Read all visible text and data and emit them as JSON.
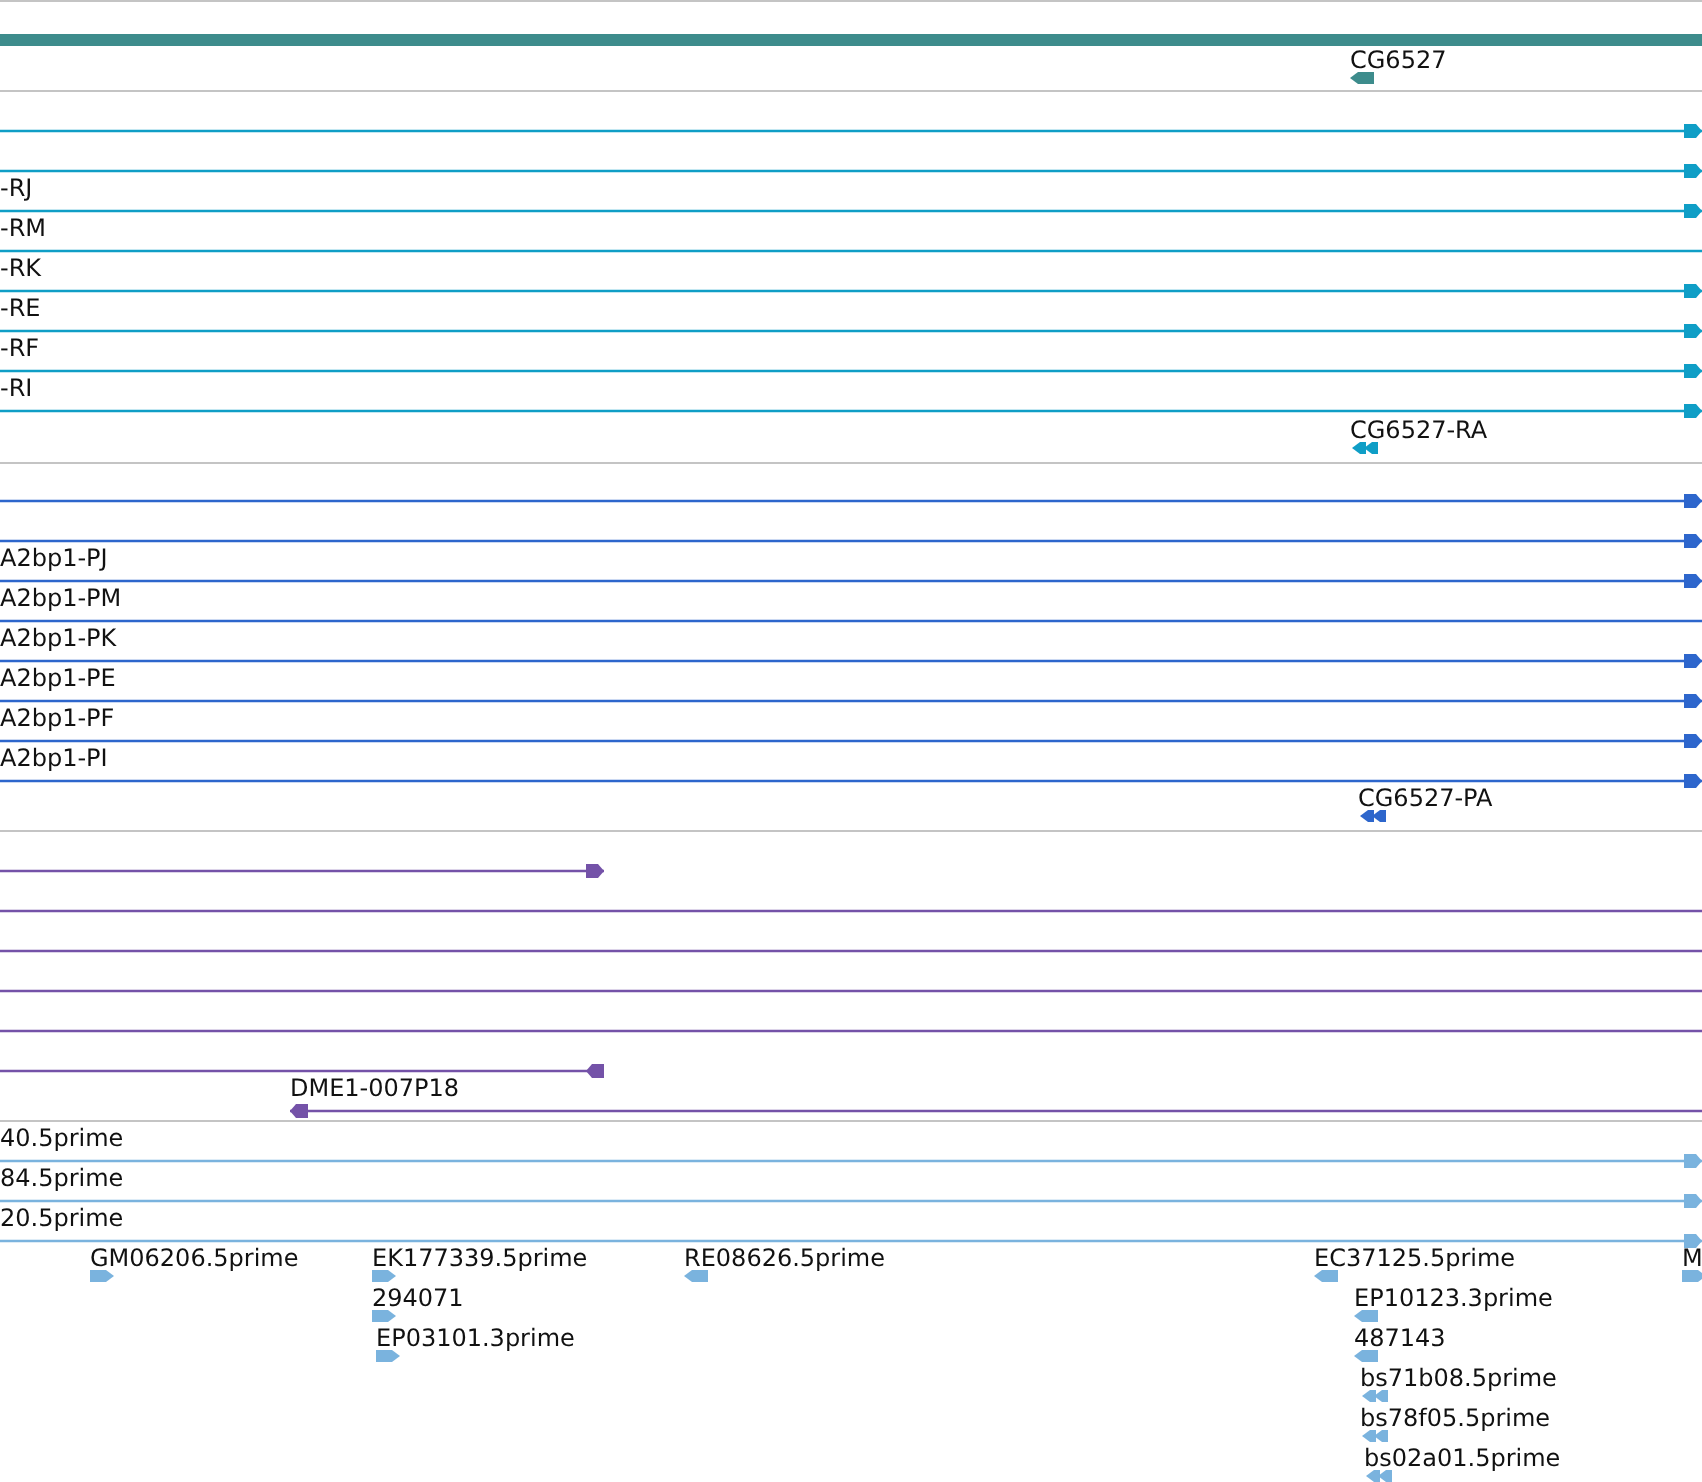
{
  "tracks": [
    {
      "kind": "gene",
      "color": "#3d8c8c",
      "features": [
        {
          "label": "CG6527",
          "reverse": true,
          "kind": "single"
        }
      ]
    },
    {
      "kind": "rows",
      "color": "#0f9ec6",
      "rows": [
        {
          "marker": true
        },
        {
          "marker": true
        },
        {
          "label": "-RJ",
          "marker": true
        },
        {
          "label": "-RM",
          "marker": false
        },
        {
          "label": "-RK",
          "marker": true
        },
        {
          "label": "-RE",
          "marker": true
        },
        {
          "label": "-RF",
          "marker": true
        },
        {
          "label": "-RI",
          "marker": true
        }
      ],
      "features": [
        {
          "label": "CG6527-RA",
          "reverse": true,
          "kind": "double"
        }
      ]
    },
    {
      "kind": "rows",
      "color": "#2d66cc",
      "rows": [
        {
          "marker": true
        },
        {
          "marker": true
        },
        {
          "label": "A2bp1-PJ",
          "marker": true
        },
        {
          "label": "A2bp1-PM",
          "marker": false
        },
        {
          "label": "A2bp1-PK",
          "marker": true
        },
        {
          "label": "A2bp1-PE",
          "marker": true
        },
        {
          "label": "A2bp1-PF",
          "marker": true
        },
        {
          "label": "A2bp1-PI",
          "marker": true
        }
      ],
      "features": [
        {
          "label": "CG6527-PA",
          "reverse": true,
          "kind": "double"
        }
      ]
    },
    {
      "kind": "rows",
      "color": "#7452a8",
      "rows": [
        {
          "marker": true,
          "reverse": false
        },
        {
          "marker": false
        },
        {
          "marker": false
        },
        {
          "marker": false
        },
        {
          "marker": false
        },
        {
          "marker": true,
          "reverse": true
        },
        {
          "label": "DME1-007P18",
          "marker": true,
          "reverse": true
        }
      ]
    },
    {
      "kind": "rows",
      "color": "#7ab3de",
      "rows": [
        {
          "label": "40.5prime",
          "marker": true
        },
        {
          "label": "84.5prime",
          "marker": true
        },
        {
          "label": "20.5prime",
          "marker": true
        }
      ],
      "features": [
        {
          "label": "GM06206.5prime",
          "reverse": false,
          "kind": "single"
        },
        {
          "label": "EK177339.5prime",
          "reverse": false,
          "kind": "single"
        },
        {
          "label": "294071",
          "reverse": false,
          "kind": "single"
        },
        {
          "label": "EP03101.3prime",
          "reverse": false,
          "kind": "single"
        },
        {
          "label": "RE08626.5prime",
          "reverse": true,
          "kind": "single"
        },
        {
          "label": "EC37125.5prime",
          "reverse": true,
          "kind": "single"
        },
        {
          "label": "M",
          "reverse": false,
          "kind": "single"
        },
        {
          "label": "EP10123.3prime",
          "reverse": true,
          "kind": "single"
        },
        {
          "label": "487143",
          "reverse": true,
          "kind": "single"
        },
        {
          "label": "bs71b08.5prime",
          "reverse": true,
          "kind": "double"
        },
        {
          "label": "bs78f05.5prime",
          "reverse": true,
          "kind": "double"
        },
        {
          "label": "bs02a01.5prime",
          "reverse": true,
          "kind": "double"
        }
      ]
    }
  ]
}
